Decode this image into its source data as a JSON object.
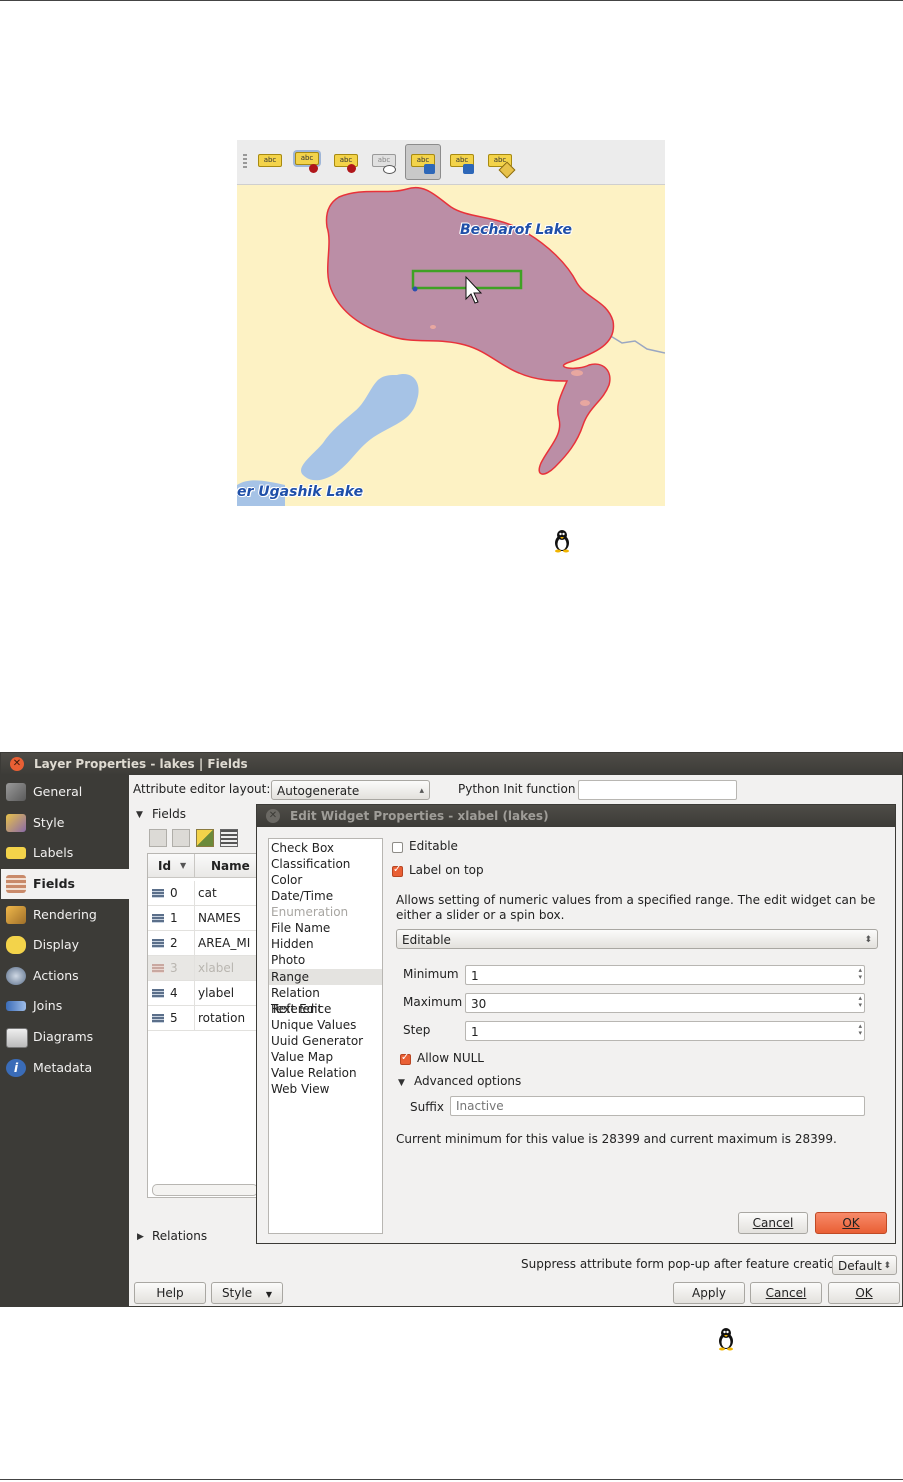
{
  "figure1": {
    "map_labels": {
      "becharof": "Becharof Lake",
      "ugashik": "er Ugashik Lake"
    },
    "toolbar_icons": [
      {
        "text": "abc",
        "icon": "label-tool-icon"
      },
      {
        "text": "abc",
        "icon": "pin-label-icon"
      },
      {
        "text": "abc",
        "icon": "pin-diagram-icon"
      },
      {
        "text": "abc",
        "icon": "show-hide-label-icon"
      },
      {
        "text": "abc",
        "icon": "move-label-icon"
      },
      {
        "text": "abc",
        "icon": "rotate-label-icon"
      },
      {
        "text": "abc",
        "icon": "change-label-icon"
      }
    ],
    "colors": {
      "map_background": "#fdf2c4",
      "lake_fill": "#bb8ea6",
      "lake_outline": "#e8323a",
      "water": "#a6c3e6",
      "selection_box": "#3fa124"
    }
  },
  "window": {
    "title": "Layer Properties - lakes | Fields",
    "sidebar": [
      {
        "label": "General",
        "icon": "general-icon"
      },
      {
        "label": "Style",
        "icon": "style-icon"
      },
      {
        "label": "Labels",
        "icon": "labels-icon"
      },
      {
        "label": "Fields",
        "icon": "fields-icon"
      },
      {
        "label": "Rendering",
        "icon": "rendering-icon"
      },
      {
        "label": "Display",
        "icon": "display-icon"
      },
      {
        "label": "Actions",
        "icon": "actions-icon"
      },
      {
        "label": "Joins",
        "icon": "joins-icon"
      },
      {
        "label": "Diagrams",
        "icon": "diagrams-icon"
      },
      {
        "label": "Metadata",
        "icon": "metadata-icon"
      }
    ],
    "attribute_editor_layout_label": "Attribute editor layout:",
    "attribute_editor_layout_value": "Autogenerate",
    "python_init_label": "Python Init function",
    "python_init_value": "",
    "fields_section": "Fields",
    "relations_section": "Relations",
    "table": {
      "headers": [
        "Id",
        "Name"
      ],
      "rows": [
        {
          "id": "0",
          "name": "cat"
        },
        {
          "id": "1",
          "name": "NAMES"
        },
        {
          "id": "2",
          "name": "AREA_MI"
        },
        {
          "id": "3",
          "name": "xlabel"
        },
        {
          "id": "4",
          "name": "ylabel"
        },
        {
          "id": "5",
          "name": "rotation"
        }
      ]
    },
    "suppress_label": "Suppress attribute form pop-up after feature creation",
    "suppress_value": "Default",
    "buttons": {
      "help": "Help",
      "style": "Style",
      "apply": "Apply",
      "cancel": "Cancel",
      "ok": "OK"
    }
  },
  "widget_dialog": {
    "title": "Edit Widget Properties - xlabel (lakes)",
    "widgets": [
      "Check Box",
      "Classification",
      "Color",
      "Date/Time",
      "Enumeration",
      "File Name",
      "Hidden",
      "Photo",
      "Range",
      "Relation Reference",
      "Text Edit",
      "Unique Values",
      "Uuid Generator",
      "Value Map",
      "Value Relation",
      "Web View"
    ],
    "editable_label": "Editable",
    "label_on_top_label": "Label on top",
    "description": "Allows setting of numeric values from a specified range. The edit widget can be either a slider or a spin box.",
    "mode_value": "Editable",
    "minimum_label": "Minimum",
    "minimum_value": "1",
    "maximum_label": "Maximum",
    "maximum_value": "30",
    "step_label": "Step",
    "step_value": "1",
    "allow_null_label": "Allow NULL",
    "advanced_label": "Advanced options",
    "suffix_label": "Suffix",
    "suffix_placeholder": "Inactive",
    "info": "Current minimum for this value is 28399 and current maximum is 28399.",
    "cancel": "Cancel",
    "ok": "OK"
  }
}
